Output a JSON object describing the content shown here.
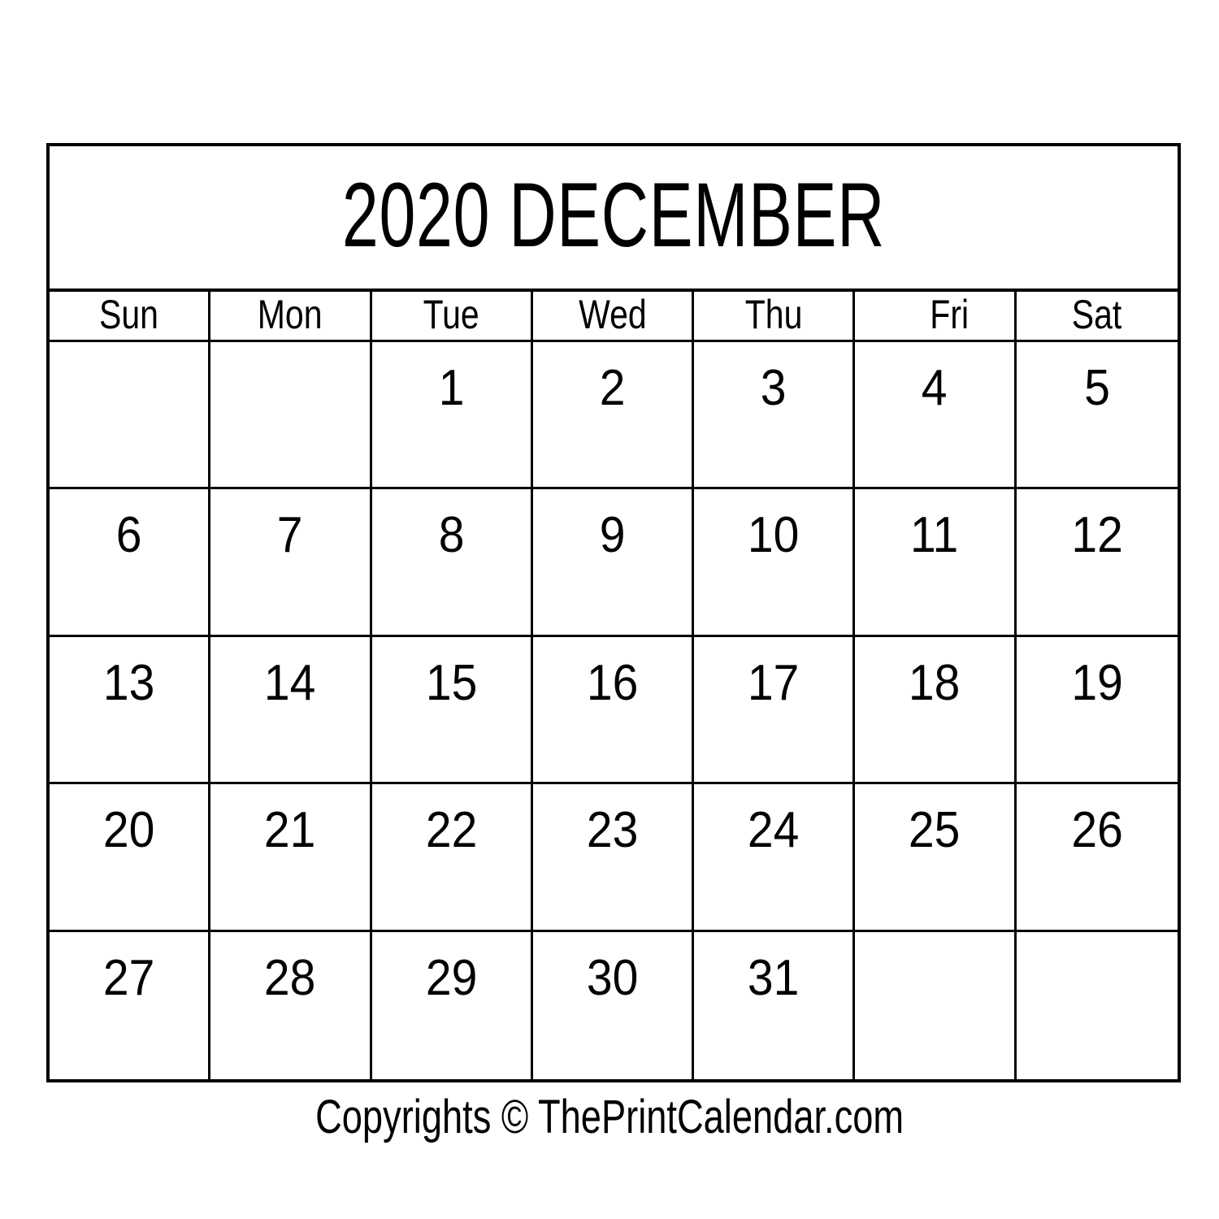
{
  "calendar": {
    "title": "2020 DECEMBER",
    "year": "2020",
    "month": "DECEMBER",
    "weekday_headers": [
      {
        "label": "Sun"
      },
      {
        "label": "Mon"
      },
      {
        "label": "Tue"
      },
      {
        "label": "Wed"
      },
      {
        "label": "Thu"
      },
      {
        "label": "Fri"
      },
      {
        "label": "Sat"
      }
    ],
    "weeks": [
      [
        {
          "day": ""
        },
        {
          "day": ""
        },
        {
          "day": "1"
        },
        {
          "day": "2"
        },
        {
          "day": "3"
        },
        {
          "day": "4"
        },
        {
          "day": "5"
        }
      ],
      [
        {
          "day": "6"
        },
        {
          "day": "7"
        },
        {
          "day": "8"
        },
        {
          "day": "9"
        },
        {
          "day": "10"
        },
        {
          "day": "11"
        },
        {
          "day": "12"
        }
      ],
      [
        {
          "day": "13"
        },
        {
          "day": "14"
        },
        {
          "day": "15"
        },
        {
          "day": "16"
        },
        {
          "day": "17"
        },
        {
          "day": "18"
        },
        {
          "day": "19"
        }
      ],
      [
        {
          "day": "20"
        },
        {
          "day": "21"
        },
        {
          "day": "22"
        },
        {
          "day": "23"
        },
        {
          "day": "24"
        },
        {
          "day": "25"
        },
        {
          "day": "26"
        }
      ],
      [
        {
          "day": "27"
        },
        {
          "day": "28"
        },
        {
          "day": "29"
        },
        {
          "day": "30"
        },
        {
          "day": "31"
        },
        {
          "day": ""
        },
        {
          "day": ""
        }
      ]
    ]
  },
  "footer": {
    "copyright": "Copyrights © ThePrintCalendar.com"
  },
  "colors": {
    "background": "#ffffff",
    "ink": "#000000",
    "grid_line": "#000000"
  }
}
